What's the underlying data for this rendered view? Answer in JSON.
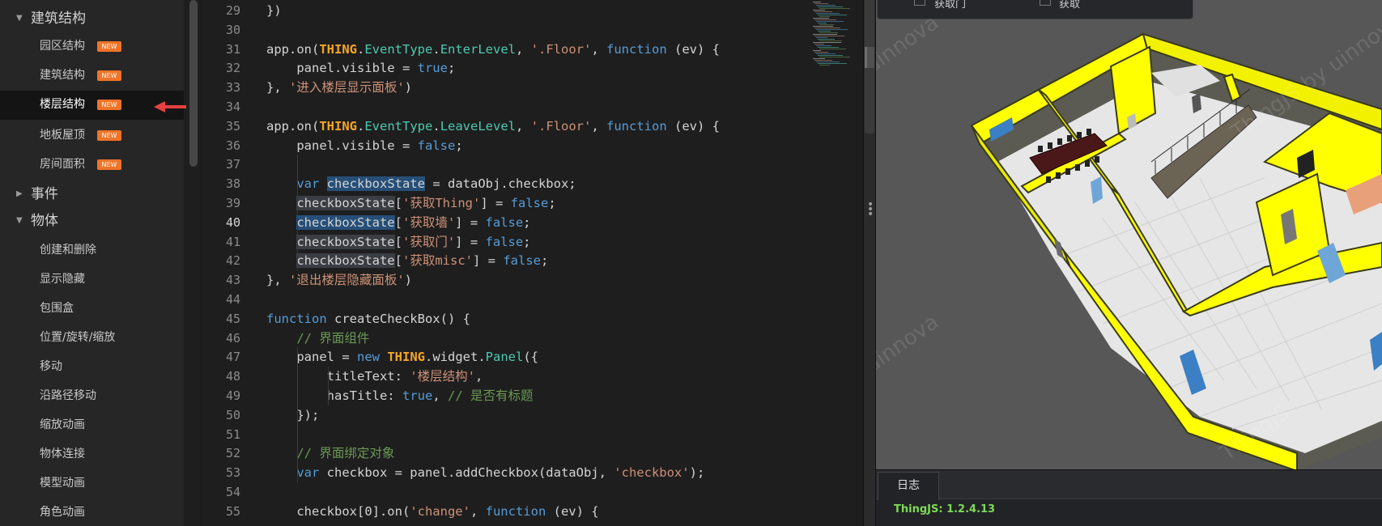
{
  "sidebar": {
    "categories": [
      {
        "label": "建筑结构",
        "expanded": true
      },
      {
        "label": "事件",
        "expanded": false
      },
      {
        "label": "物体",
        "expanded": true
      }
    ],
    "building_items": [
      {
        "label": "园区结构",
        "badge": "NEW",
        "active": false
      },
      {
        "label": "建筑结构",
        "badge": "NEW",
        "active": false
      },
      {
        "label": "楼层结构",
        "badge": "NEW",
        "active": true
      },
      {
        "label": "地板屋顶",
        "badge": "NEW",
        "active": false
      },
      {
        "label": "房间面积",
        "badge": "NEW",
        "active": false
      }
    ],
    "object_items": [
      "创建和删除",
      "显示隐藏",
      "包围盒",
      "位置/旋转/缩放",
      "移动",
      "沿路径移动",
      "缩放动画",
      "物体连接",
      "模型动画",
      "角色动画"
    ]
  },
  "editor": {
    "current_line": 40,
    "lines": [
      {
        "n": 29,
        "tokens": [
          [
            "plain",
            "})"
          ]
        ]
      },
      {
        "n": 30,
        "tokens": []
      },
      {
        "n": 31,
        "tokens": [
          [
            "plain",
            "app.on("
          ],
          [
            "thing",
            "THING"
          ],
          [
            "plain",
            "."
          ],
          [
            "prop",
            "EventType"
          ],
          [
            "plain",
            "."
          ],
          [
            "prop",
            "EnterLevel"
          ],
          [
            "plain",
            ", "
          ],
          [
            "str",
            "'.Floor'"
          ],
          [
            "plain",
            ", "
          ],
          [
            "kw",
            "function"
          ],
          [
            "plain",
            " (ev) {"
          ]
        ]
      },
      {
        "n": 32,
        "tokens": [
          [
            "plain",
            "    panel.visible = "
          ],
          [
            "kw",
            "true"
          ],
          [
            "plain",
            ";"
          ]
        ]
      },
      {
        "n": 33,
        "tokens": [
          [
            "plain",
            "}, "
          ],
          [
            "str",
            "'进入楼层显示面板'"
          ],
          [
            "plain",
            ")"
          ]
        ]
      },
      {
        "n": 34,
        "tokens": []
      },
      {
        "n": 35,
        "tokens": [
          [
            "plain",
            "app.on("
          ],
          [
            "thing",
            "THING"
          ],
          [
            "plain",
            "."
          ],
          [
            "prop",
            "EventType"
          ],
          [
            "plain",
            "."
          ],
          [
            "prop",
            "LeaveLevel"
          ],
          [
            "plain",
            ", "
          ],
          [
            "str",
            "'.Floor'"
          ],
          [
            "plain",
            ", "
          ],
          [
            "kw",
            "function"
          ],
          [
            "plain",
            " (ev) {"
          ]
        ]
      },
      {
        "n": 36,
        "tokens": [
          [
            "plain",
            "    panel.visible = "
          ],
          [
            "kw",
            "false"
          ],
          [
            "plain",
            ";"
          ]
        ]
      },
      {
        "n": 37,
        "tokens": []
      },
      {
        "n": 38,
        "tokens": [
          [
            "plain",
            "    "
          ],
          [
            "kw",
            "var"
          ],
          [
            "plain",
            " "
          ],
          [
            "hl",
            "checkboxState"
          ],
          [
            "plain",
            " = dataObj.checkbox;"
          ]
        ]
      },
      {
        "n": 39,
        "tokens": [
          [
            "plain",
            "    "
          ],
          [
            "hl2",
            "checkboxState"
          ],
          [
            "plain",
            "["
          ],
          [
            "str",
            "'获取Thing'"
          ],
          [
            "plain",
            "] = "
          ],
          [
            "kw",
            "false"
          ],
          [
            "plain",
            ";"
          ]
        ]
      },
      {
        "n": 40,
        "tokens": [
          [
            "plain",
            "    "
          ],
          [
            "hl",
            "checkboxState"
          ],
          [
            "plain",
            "["
          ],
          [
            "str",
            "'获取墙'"
          ],
          [
            "plain",
            "] = "
          ],
          [
            "kw",
            "false"
          ],
          [
            "plain",
            ";"
          ]
        ]
      },
      {
        "n": 41,
        "tokens": [
          [
            "plain",
            "    "
          ],
          [
            "hl2",
            "checkboxState"
          ],
          [
            "plain",
            "["
          ],
          [
            "str",
            "'获取门'"
          ],
          [
            "plain",
            "] = "
          ],
          [
            "kw",
            "false"
          ],
          [
            "plain",
            ";"
          ]
        ]
      },
      {
        "n": 42,
        "tokens": [
          [
            "plain",
            "    "
          ],
          [
            "hl2",
            "checkboxState"
          ],
          [
            "plain",
            "["
          ],
          [
            "str",
            "'获取misc'"
          ],
          [
            "plain",
            "] = "
          ],
          [
            "kw",
            "false"
          ],
          [
            "plain",
            ";"
          ]
        ]
      },
      {
        "n": 43,
        "tokens": [
          [
            "plain",
            "}, "
          ],
          [
            "str",
            "'退出楼层隐藏面板'"
          ],
          [
            "plain",
            ")"
          ]
        ]
      },
      {
        "n": 44,
        "tokens": []
      },
      {
        "n": 45,
        "tokens": [
          [
            "kw",
            "function"
          ],
          [
            "plain",
            " createCheckBox() {"
          ]
        ]
      },
      {
        "n": 46,
        "tokens": [
          [
            "plain",
            "    "
          ],
          [
            "com",
            "// 界面组件"
          ]
        ]
      },
      {
        "n": 47,
        "tokens": [
          [
            "plain",
            "    panel = "
          ],
          [
            "kw",
            "new"
          ],
          [
            "plain",
            " "
          ],
          [
            "thing",
            "THING"
          ],
          [
            "plain",
            ".widget."
          ],
          [
            "prop",
            "Panel"
          ],
          [
            "plain",
            "({"
          ]
        ]
      },
      {
        "n": 48,
        "tokens": [
          [
            "plain",
            "        titleText: "
          ],
          [
            "str",
            "'楼层结构'"
          ],
          [
            "plain",
            ","
          ]
        ]
      },
      {
        "n": 49,
        "tokens": [
          [
            "plain",
            "        hasTitle: "
          ],
          [
            "kw",
            "true"
          ],
          [
            "plain",
            ", "
          ],
          [
            "com",
            "// 是否有标题"
          ]
        ]
      },
      {
        "n": 50,
        "tokens": [
          [
            "plain",
            "    });"
          ]
        ]
      },
      {
        "n": 51,
        "tokens": []
      },
      {
        "n": 52,
        "tokens": [
          [
            "plain",
            "    "
          ],
          [
            "com",
            "// 界面绑定对象"
          ]
        ]
      },
      {
        "n": 53,
        "tokens": [
          [
            "plain",
            "    "
          ],
          [
            "kw",
            "var"
          ],
          [
            "plain",
            " checkbox = panel.addCheckbox(dataObj, "
          ],
          [
            "str",
            "'checkbox'"
          ],
          [
            "plain",
            ");"
          ]
        ]
      },
      {
        "n": 54,
        "tokens": []
      },
      {
        "n": 55,
        "tokens": [
          [
            "plain",
            "    checkbox[0].on("
          ],
          [
            "str",
            "'change'"
          ],
          [
            "plain",
            ", "
          ],
          [
            "kw",
            "function"
          ],
          [
            "plain",
            " (ev) {"
          ]
        ]
      }
    ]
  },
  "viewport": {
    "overlay_checkboxes": [
      "获取门",
      "获取"
    ],
    "watermarks": [
      "uinnova",
      "ThingJS by uinnova",
      "uinnova",
      "ThingJS"
    ]
  },
  "log": {
    "tab_label": "日志",
    "version_text": "ThingJS: 1.2.4.13"
  },
  "colors": {
    "badge": "#f07328",
    "wall_yellow": "#ffff00",
    "floor": "#e8e8e8",
    "accent_arrow": "#e84040"
  }
}
